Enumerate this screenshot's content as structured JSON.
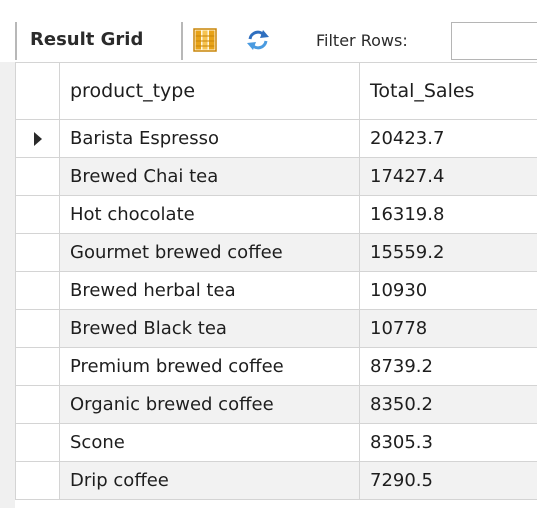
{
  "toolbar": {
    "result_grid_label": "Result Grid",
    "filter_label": "Filter Rows:",
    "filter_value": "",
    "icons": [
      "grid-layout-icon",
      "refresh-icon"
    ],
    "colors": {
      "grid_icon": "#e8a317",
      "refresh_icon": "#2f6fbf"
    }
  },
  "grid": {
    "columns": [
      "product_type",
      "Total_Sales"
    ],
    "selected_row": 0,
    "rows": [
      {
        "product_type": "Barista Espresso",
        "total_sales": "20423.7"
      },
      {
        "product_type": "Brewed Chai tea",
        "total_sales": "17427.4"
      },
      {
        "product_type": "Hot chocolate",
        "total_sales": "16319.8"
      },
      {
        "product_type": "Gourmet brewed coffee",
        "total_sales": "15559.2"
      },
      {
        "product_type": "Brewed herbal tea",
        "total_sales": "10930"
      },
      {
        "product_type": "Brewed Black tea",
        "total_sales": "10778"
      },
      {
        "product_type": "Premium brewed coffee",
        "total_sales": "8739.2"
      },
      {
        "product_type": "Organic brewed coffee",
        "total_sales": "8350.2"
      },
      {
        "product_type": "Scone",
        "total_sales": "8305.3"
      },
      {
        "product_type": "Drip coffee",
        "total_sales": "7290.5"
      }
    ]
  }
}
